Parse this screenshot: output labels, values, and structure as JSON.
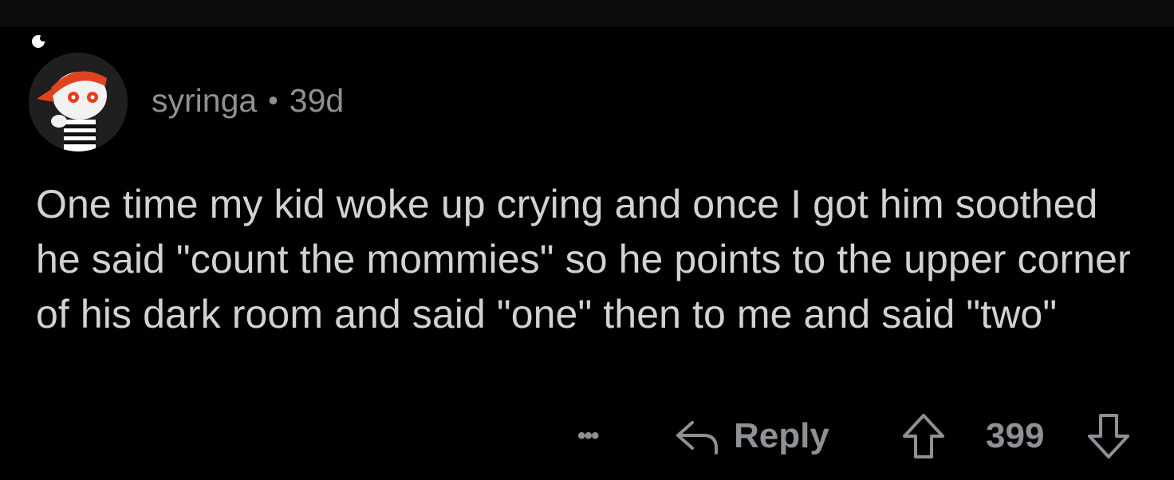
{
  "comment": {
    "author": "syringa",
    "separator": "•",
    "age": "39d",
    "body": "One time my kid woke up crying and once I got him soothed he said \"count the mommies\" so he points to the upper corner of his dark room and said \"one\" then to me and said \"two\"",
    "avatar_icon": "snoo-avatar-icon",
    "thread_icon": "thread-line-icon"
  },
  "actions": {
    "more_label": "•••",
    "reply_label": "Reply",
    "reply_icon": "reply-arrow-icon",
    "upvote_icon": "upvote-arrow-icon",
    "score": "399",
    "downvote_icon": "downvote-arrow-icon"
  },
  "colors": {
    "background": "#000000",
    "text_primary": "#d0d3d4",
    "text_secondary": "#8e9194",
    "avatar_accent": "#e2421e"
  }
}
